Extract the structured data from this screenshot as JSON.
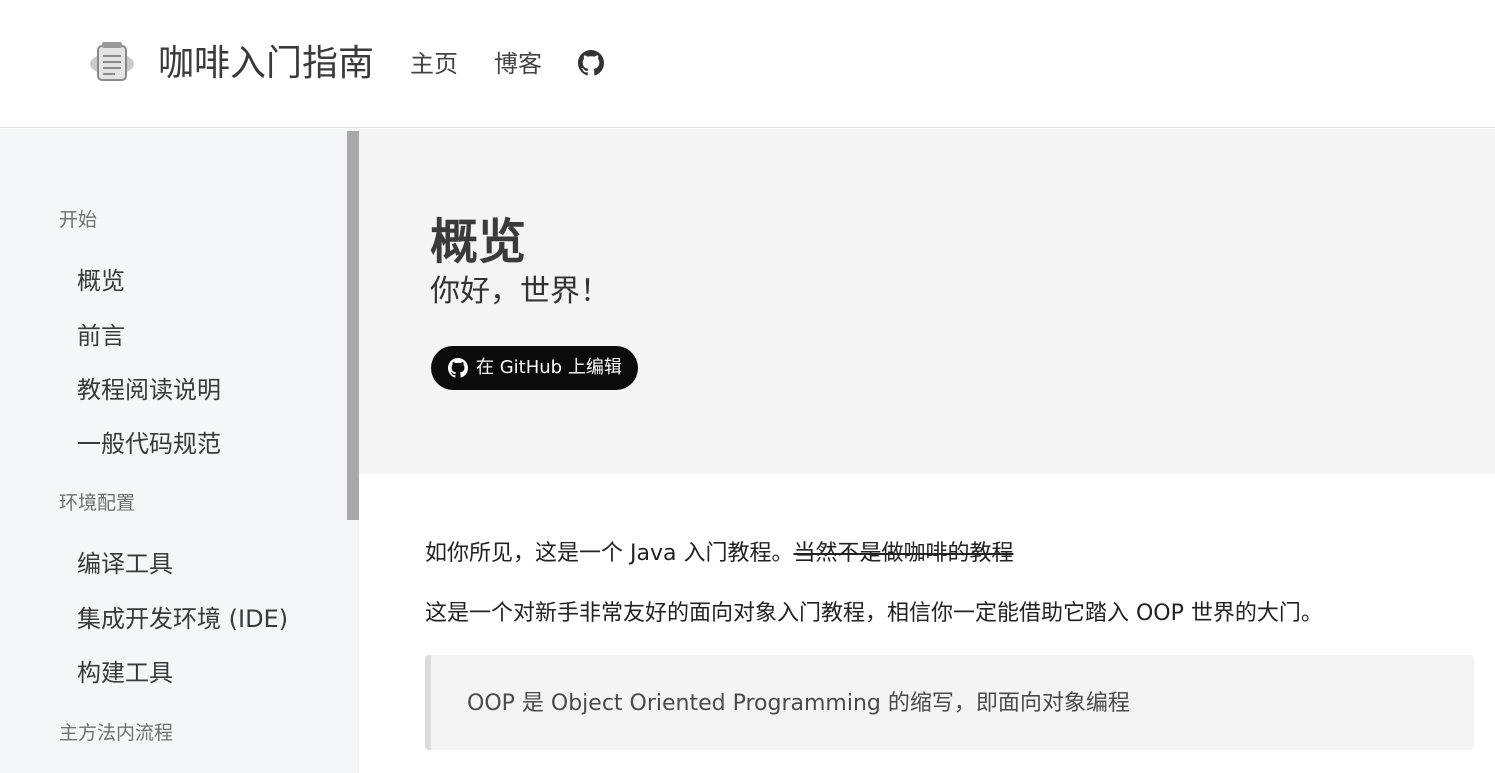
{
  "header": {
    "site_title": "咖啡入门指南",
    "nav": {
      "home": "主页",
      "blog": "博客"
    },
    "logo_icon": "notebook-icon",
    "github_icon": "github-icon"
  },
  "sidebar": {
    "sections": [
      {
        "title": "开始",
        "items": [
          "概览",
          "前言",
          "教程阅读说明",
          "一般代码规范"
        ]
      },
      {
        "title": "环境配置",
        "items": [
          "编译工具",
          "集成开发环境 (IDE)",
          "构建工具"
        ]
      },
      {
        "title": "主方法内流程",
        "items": []
      }
    ]
  },
  "hero": {
    "title": "概览",
    "subtitle": "你好，世界！",
    "edit_button": "在 GitHub 上编辑"
  },
  "content": {
    "para1_main": "如你所见，这是一个 Java 入门教程。",
    "para1_strike": "当然不是做咖啡的教程",
    "para2": "这是一个对新手非常友好的面向对象入门教程，相信你一定能借助它踏入 OOP 世界的大门。",
    "quote": "OOP 是 Object Oriented Programming 的缩写，即面向对象编程"
  },
  "colors": {
    "sidebar_bg": "#f5f6f7",
    "hero_bg": "#f4f4f4",
    "button_bg": "#0b0b0b",
    "scrollbar": "#a9a9a9"
  }
}
